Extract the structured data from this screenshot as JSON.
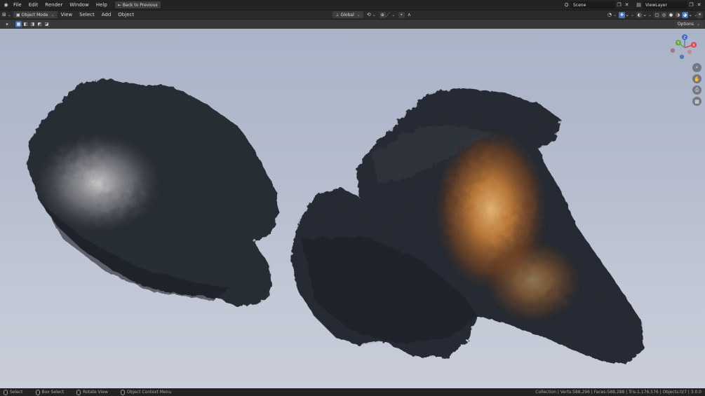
{
  "topbar": {
    "menus": [
      "File",
      "Edit",
      "Render",
      "Window",
      "Help"
    ],
    "back_button": "Back to Previous",
    "scene_label": "Scene",
    "viewlayer_label": "ViewLayer"
  },
  "header": {
    "mode": "Object Mode",
    "menus": [
      "View",
      "Select",
      "Add",
      "Object"
    ],
    "orientation": "Global"
  },
  "toolheader": {
    "options_label": "Options"
  },
  "gizmo": {
    "x": "X",
    "y": "Y",
    "z": "Z"
  },
  "statusbar": {
    "select": "Select",
    "box_select": "Box Select",
    "rotate_view": "Rotate View",
    "context_menu": "Object Context Menu",
    "stats": "Collection | Verts:588,296 | Faces:588,288 | Tris:1,176,576 | Objects:0/7 | 3.0.0"
  },
  "colors": {
    "accent": "#4772b3",
    "rock_dark": "#2b3038",
    "light_orange": "#d88a3e",
    "light_white": "#d5d5d5"
  }
}
